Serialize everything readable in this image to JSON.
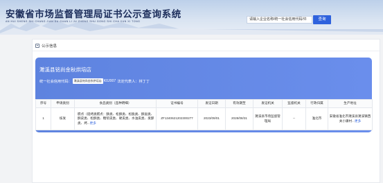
{
  "header": {
    "title": "安徽省市场监督管理局证书公示查询系统",
    "subtitle": "AN HUI SHENG SHI CHANG JIAN DU GUAN LI JU ZHENG SHU GONG SHI CHA XUN XI TONG",
    "search_value": "请输入企业名称/统一社会信用代码/许",
    "search_button": "查询"
  },
  "breadcrumb": {
    "label": "公示信息"
  },
  "company": {
    "name": "濉溪县铭尚金秋烘培店",
    "code_label": "统一社会信用代码：",
    "code_value": "濉溪县铭尚金秋烘培店",
    "code_suffix": "K0J007",
    "rep_label": "法定代表人：",
    "rep_value": "林丁丁"
  },
  "table": {
    "columns": [
      "序号",
      "申请类别",
      "食品类别（品种明细）",
      "证书编号",
      "发证日期",
      "有效期至",
      "发证机关",
      "监督机关",
      "行政归属",
      "生产地址"
    ],
    "rows": [
      {
        "index": "1",
        "type": "核发",
        "food": "糕点（焙烤类糕点：酥类、松酥类、松脆类、酥层类、酥皮类、松酥类、糖浆皮类、硬皮类、水油皮类、发酵类、烤...",
        "food_more": "更多",
        "cert_no": "ZF1340621202300277",
        "issue_date": "2023/09/01",
        "expiry": "2028/08/31",
        "authority": "濉溪县市场监督管理局",
        "supervisor": "--",
        "admin": "淮北市",
        "address": "安徽省淮北市濉溪县濉溪镇西关小康村...",
        "address_more": "更多"
      }
    ]
  }
}
